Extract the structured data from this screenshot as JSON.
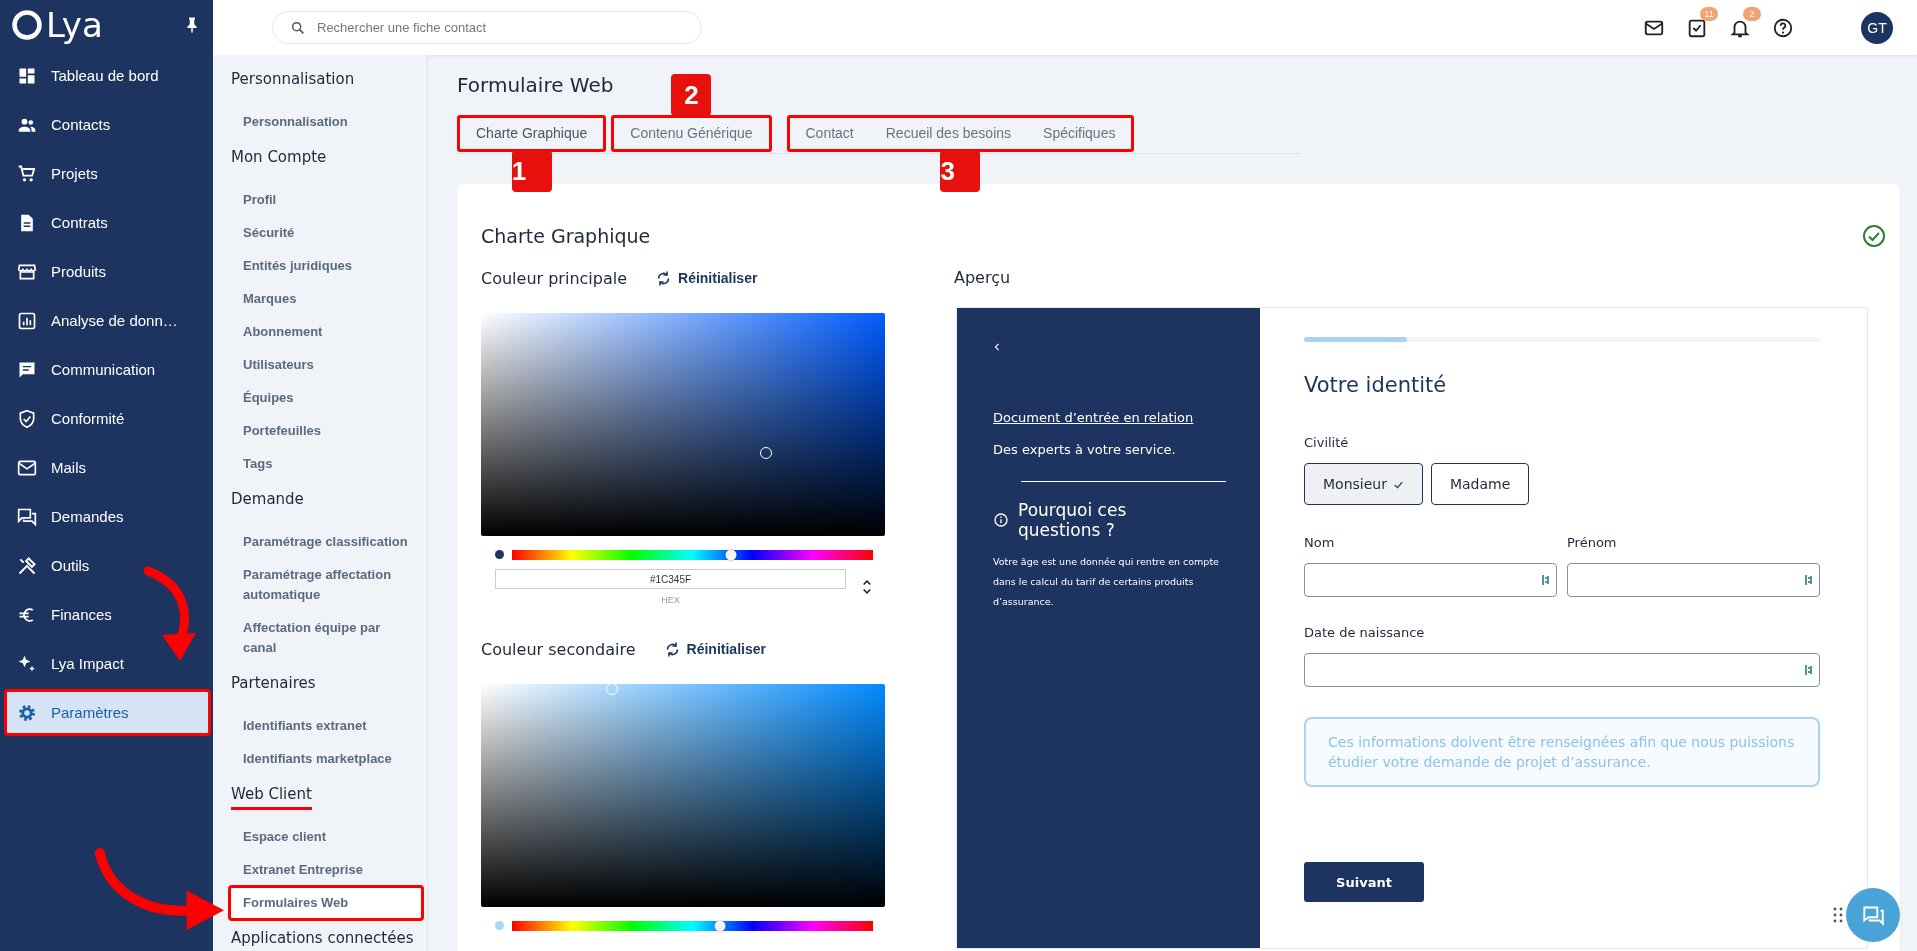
{
  "sidebar": {
    "logo": "Lya",
    "items": [
      {
        "label": "Tableau de bord",
        "selected": false,
        "annotated": false
      },
      {
        "label": "Contacts",
        "selected": false,
        "annotated": false
      },
      {
        "label": "Projets",
        "selected": false,
        "annotated": false
      },
      {
        "label": "Contrats",
        "selected": false,
        "annotated": false
      },
      {
        "label": "Produits",
        "selected": false,
        "annotated": false
      },
      {
        "label": "Analyse de donn…",
        "selected": false,
        "annotated": false
      },
      {
        "label": "Communication",
        "selected": false,
        "annotated": false
      },
      {
        "label": "Conformité",
        "selected": false,
        "annotated": false
      },
      {
        "label": "Mails",
        "selected": false,
        "annotated": false
      },
      {
        "label": "Demandes",
        "selected": false,
        "annotated": false
      },
      {
        "label": "Outils",
        "selected": false,
        "annotated": false
      },
      {
        "label": "Finances",
        "selected": false,
        "annotated": false
      },
      {
        "label": "Lya Impact",
        "selected": false,
        "annotated": false
      },
      {
        "label": "Paramètres",
        "selected": true,
        "annotated": true
      }
    ]
  },
  "topbar": {
    "search": {
      "placeholder": "Rechercher une fiche contact"
    },
    "tasks_badge": "11",
    "notifications_badge": "2",
    "avatar": "GT"
  },
  "settings_menu": {
    "sections": [
      {
        "title": "Personnalisation",
        "underlined": false,
        "items": [
          {
            "label": "Personnalisation",
            "selected": false,
            "annotated": false
          }
        ]
      },
      {
        "title": "Mon Compte",
        "underlined": false,
        "items": [
          {
            "label": "Profil",
            "selected": false,
            "annotated": false
          },
          {
            "label": "Sécurité",
            "selected": false,
            "annotated": false
          },
          {
            "label": "Entités juridiques",
            "selected": false,
            "annotated": false
          },
          {
            "label": "Marques",
            "selected": false,
            "annotated": false
          },
          {
            "label": "Abonnement",
            "selected": false,
            "annotated": false
          },
          {
            "label": "Utilisateurs",
            "selected": false,
            "annotated": false
          },
          {
            "label": "Équipes",
            "selected": false,
            "annotated": false
          },
          {
            "label": "Portefeuilles",
            "selected": false,
            "annotated": false
          },
          {
            "label": "Tags",
            "selected": false,
            "annotated": false
          }
        ]
      },
      {
        "title": "Demande",
        "underlined": false,
        "items": [
          {
            "label": "Paramétrage classification",
            "selected": false,
            "annotated": false
          },
          {
            "label": "Paramétrage affectation automatique",
            "selected": false,
            "annotated": false
          },
          {
            "label": "Affectation équipe par canal",
            "selected": false,
            "annotated": false
          }
        ]
      },
      {
        "title": "Partenaires",
        "underlined": false,
        "items": [
          {
            "label": "Identifiants extranet",
            "selected": false,
            "annotated": false
          },
          {
            "label": "Identifiants marketplace",
            "selected": false,
            "annotated": false
          }
        ]
      },
      {
        "title": "Web Client",
        "underlined": true,
        "items": [
          {
            "label": "Espace client",
            "selected": false,
            "annotated": false
          },
          {
            "label": "Extranet Entreprise",
            "selected": false,
            "annotated": false
          },
          {
            "label": "Formulaires Web",
            "selected": true,
            "annotated": true
          }
        ]
      },
      {
        "title": "Applications connectées"
      }
    ]
  },
  "page": {
    "title": "Formulaire Web",
    "tab_groups": [
      {
        "badge": "1",
        "badge_above": false,
        "tabs": [
          {
            "label": "Charte Graphique",
            "selected": true
          }
        ]
      },
      {
        "badge": "2",
        "badge_above": true,
        "tabs": [
          {
            "label": "Contenu Générique",
            "selected": false
          }
        ]
      },
      {
        "badge": "3",
        "badge_above": false,
        "tabs": [
          {
            "label": "Contact",
            "selected": false
          },
          {
            "label": "Recueil des besoins",
            "selected": false
          },
          {
            "label": "Spécifiques",
            "selected": false
          }
        ]
      }
    ]
  },
  "card": {
    "title": "Charte Graphique",
    "saved": true,
    "colors": [
      {
        "label": "Couleur principale",
        "reset": "Réinitialiser",
        "color": "#1c345f",
        "level": 0.607,
        "hex": "#1C345F",
        "hex_label": "HEX"
      },
      {
        "label": "Couleur secondaire",
        "reset": "Réinitialiser",
        "color": "#a8d5f9",
        "level": 0.576
      }
    ],
    "preview": {
      "label": "Aperçu",
      "link": "Document d’entrée en relation",
      "tagline": "Des experts à votre service.",
      "info_title": "Pourquoi ces questions ?",
      "info_text": "Votre âge est une donnée qui rentre en compte dans le calcul du tarif de certains produits d’assurance.",
      "progress": {
        "level": 0.2
      },
      "heading": "Votre identité",
      "civility": {
        "label": "Civilité",
        "options": [
          {
            "label": "Monsieur",
            "selected": true
          },
          {
            "label": "Madame",
            "selected": false
          }
        ]
      },
      "fields": [
        {
          "label": "Nom"
        },
        {
          "label": "Prénom"
        },
        {
          "label": "Date de naissance"
        }
      ],
      "notice": "Ces informations doivent être renseignées afin que nous puissions étudier votre demande de projet d’assurance.",
      "next_button": "Suivant"
    }
  }
}
